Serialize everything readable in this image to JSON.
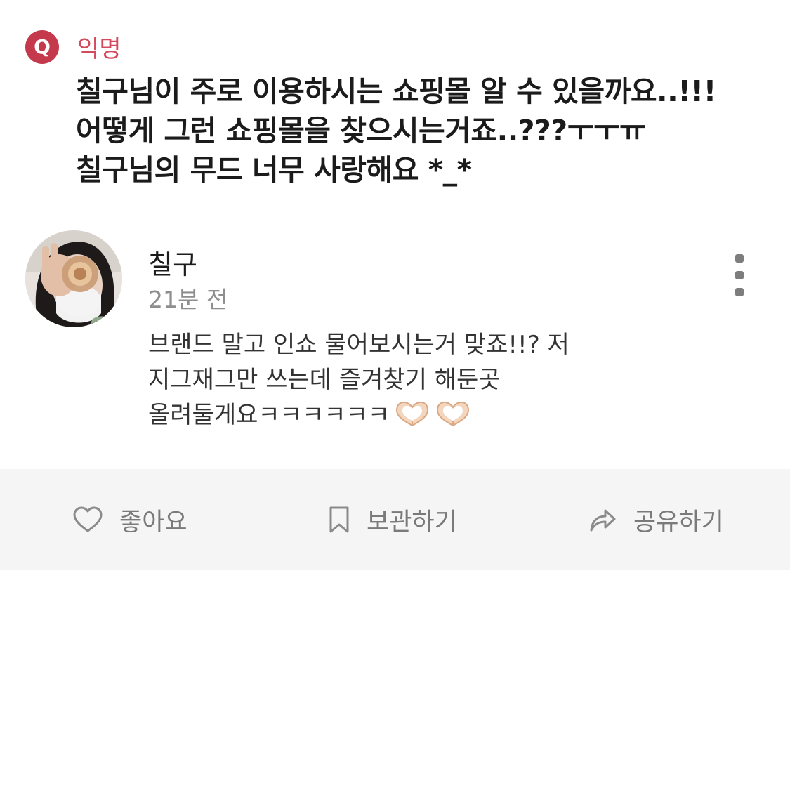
{
  "question": {
    "badge": "Q",
    "asker": "익명",
    "lines": [
      "칠구님이 주로 이용하시는 쇼핑몰 알 수 있을까요..!!!",
      "어떻게 그런 쇼핑몰을 찾으시는거죠..???ㅜㅜㅠ",
      "칠구님의 무드 너무 사랑해요 *_*"
    ]
  },
  "answer": {
    "author": "칠구",
    "time": "21분 전",
    "lines": [
      "브랜드 말고 인쇼 물어보시는거 맞죠!!? 저",
      "지그재그만 쓰는데 즐겨찾기 해둔곳",
      "올려둘게요ㅋㅋㅋㅋㅋㅋ"
    ],
    "emojis": [
      "heart-hands-icon",
      "heart-hands-icon"
    ]
  },
  "actions": {
    "like": "좋아요",
    "save": "보관하기",
    "share": "공유하기"
  },
  "colors": {
    "accent": "#c5394c",
    "action_bar": "#f5f5f5",
    "muted": "#7a7a7a"
  }
}
